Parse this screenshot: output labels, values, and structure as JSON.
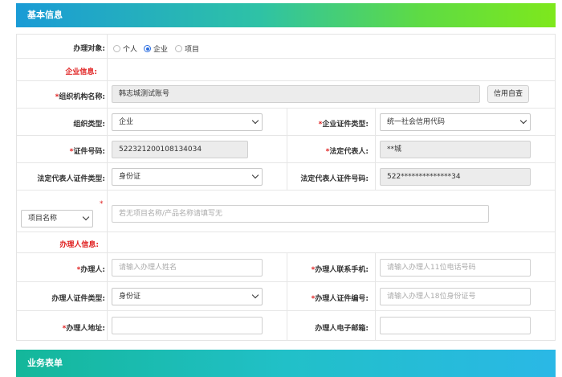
{
  "section_basic": "基本信息",
  "section_business": "业务表单",
  "handle_target": {
    "label": "办理对象:",
    "options": [
      "个人",
      "企业",
      "项目"
    ],
    "selected": "企业"
  },
  "enterprise_section": "企业信息:",
  "org_name": {
    "label": "组织机构名称:",
    "value": "韩志城测试账号",
    "button": "信用自查"
  },
  "org_type": {
    "label": "组织类型:",
    "value": "企业"
  },
  "cert_type": {
    "label": "企业证件类型:",
    "value": "统一社会信用代码"
  },
  "cert_no": {
    "label": "证件号码:",
    "value": "522321200108134034"
  },
  "legal_rep": {
    "label": "法定代表人:",
    "value": "**城"
  },
  "legal_id_type": {
    "label": "法定代表人证件类型:",
    "value": "身份证"
  },
  "legal_id_no": {
    "label": "法定代表人证件号码:",
    "value": "522**************34"
  },
  "project": {
    "select": "项目名称",
    "placeholder": "若无项目名称/产品名称请填写无"
  },
  "agent_section": "办理人信息:",
  "agent": {
    "label": "办理人:",
    "placeholder": "请输入办理人姓名"
  },
  "agent_phone": {
    "label": "办理人联系手机:",
    "placeholder": "请输入办理人11位电话号码"
  },
  "agent_id_type": {
    "label": "办理人证件类型:",
    "value": "身份证"
  },
  "agent_id_no": {
    "label": "办理人证件编号:",
    "placeholder": "请输入办理人18位身份证号"
  },
  "agent_addr": {
    "label": "办理人地址:",
    "value": ""
  },
  "agent_email": {
    "label": "办理人电子邮箱:",
    "value": ""
  },
  "colors": {
    "required": "#e02020",
    "radio_selected": "#2b6de0"
  }
}
